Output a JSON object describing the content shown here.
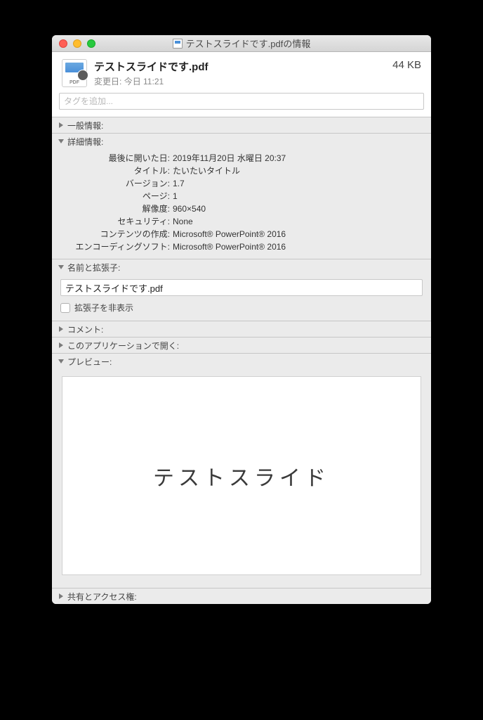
{
  "window": {
    "title": "テストスライドです.pdfの情報"
  },
  "header": {
    "filename": "テストスライドです.pdf",
    "modified_label": "変更日:",
    "modified_value": "今日 11:21",
    "filesize": "44 KB"
  },
  "tags": {
    "placeholder": "タグを追加..."
  },
  "sections": {
    "general": {
      "label": "一般情報:"
    },
    "detail": {
      "label": "詳細情報:",
      "rows": [
        {
          "label": "最後に開いた日:",
          "value": "2019年11月20日 水曜日 20:37"
        },
        {
          "label": "タイトル:",
          "value": "たいたいタイトル"
        },
        {
          "label": "バージョン:",
          "value": "1.7"
        },
        {
          "label": "ページ:",
          "value": "1"
        },
        {
          "label": "解像度:",
          "value": "960×540"
        },
        {
          "label": "セキュリティ:",
          "value": "None"
        },
        {
          "label": "コンテンツの作成:",
          "value": "Microsoft® PowerPoint® 2016"
        },
        {
          "label": "エンコーディングソフト:",
          "value": "Microsoft® PowerPoint® 2016"
        }
      ]
    },
    "name_ext": {
      "label": "名前と拡張子:",
      "filename": "テストスライドです.pdf",
      "hide_ext_label": "拡張子を非表示"
    },
    "comment": {
      "label": "コメント:"
    },
    "open_with": {
      "label": "このアプリケーションで開く:"
    },
    "preview": {
      "label": "プレビュー:",
      "content": "テストスライド"
    },
    "sharing": {
      "label": "共有とアクセス権:"
    }
  }
}
